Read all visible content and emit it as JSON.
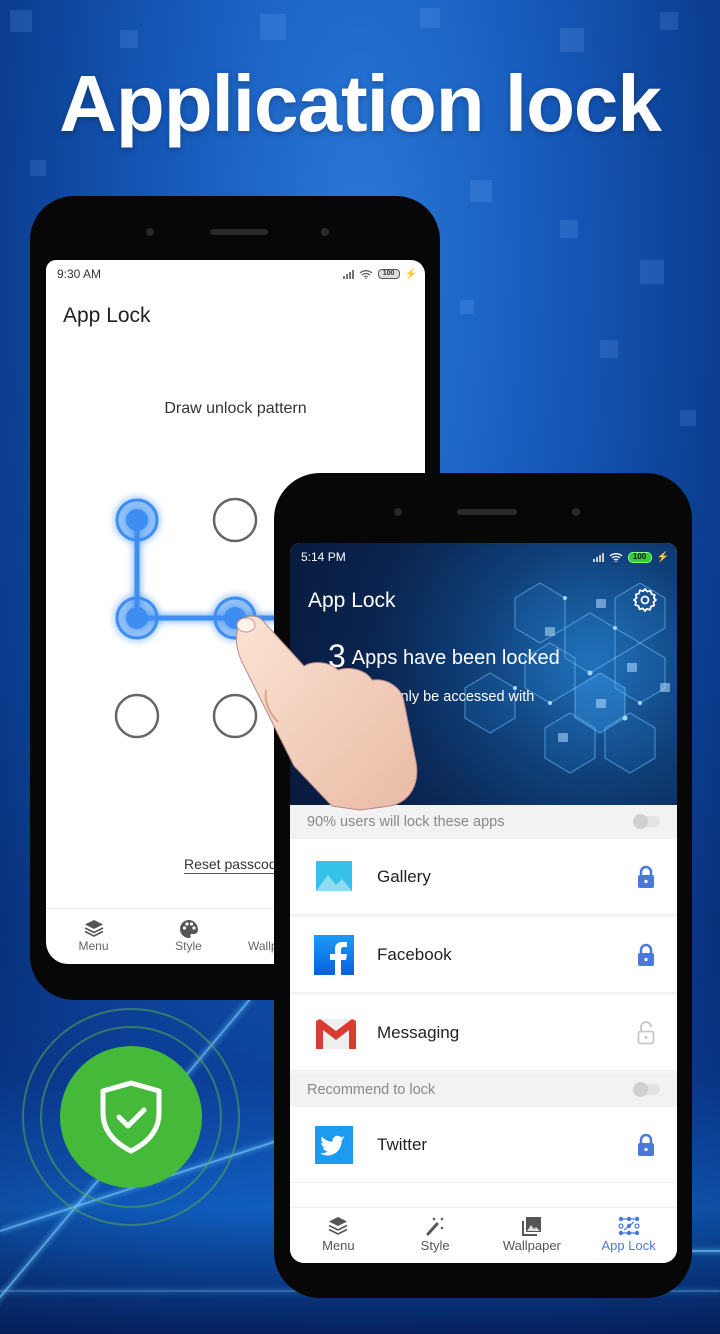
{
  "headline": "Application lock",
  "phone_left": {
    "status_bar": {
      "time": "9:30 AM",
      "battery": "100"
    },
    "title": "App Lock",
    "prompt": "Draw unlock pattern",
    "reset_link": "Reset passcode",
    "bottom_nav": [
      {
        "icon": "layers-icon",
        "label": "Menu"
      },
      {
        "icon": "palette-icon",
        "label": "Style"
      },
      {
        "icon": "wallpaper-icon",
        "label": "Wallpaper"
      }
    ]
  },
  "phone_right": {
    "status_bar": {
      "time": "5:14 PM",
      "battery": "100"
    },
    "title": "App Lock",
    "locked_count": "3",
    "locked_label": "Apps have been locked",
    "subtitle": "Apps can only be accessed with password",
    "sections": [
      {
        "label": "90% users will lock these apps",
        "toggle_on": false
      },
      {
        "label": "Recommend to lock",
        "toggle_on": false
      }
    ],
    "apps": [
      {
        "name": "Gallery",
        "icon": "gallery-icon",
        "locked": true
      },
      {
        "name": "Facebook",
        "icon": "facebook-icon",
        "locked": true
      },
      {
        "name": "Messaging",
        "icon": "gmail-icon",
        "locked": false
      },
      {
        "name": "Twitter",
        "icon": "twitter-icon",
        "locked": true
      }
    ],
    "bottom_nav": [
      {
        "icon": "layers-icon",
        "label": "Menu",
        "active": false
      },
      {
        "icon": "magic-wand-icon",
        "label": "Style",
        "active": false
      },
      {
        "icon": "wallpaper-icon",
        "label": "Wallpaper",
        "active": false
      },
      {
        "icon": "pattern-lock-icon",
        "label": "App Lock",
        "active": true
      }
    ]
  },
  "colors": {
    "accent": "#4a79d9",
    "pattern_blue": "#3d8ef0",
    "shield_green": "#44b93a",
    "background_blue": "#1558b8"
  }
}
